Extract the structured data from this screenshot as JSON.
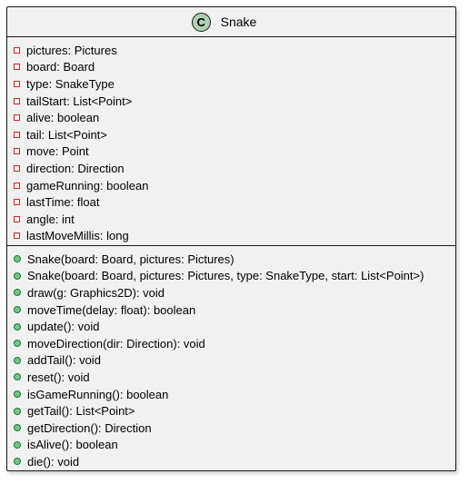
{
  "class": {
    "icon_letter": "C",
    "name": "Snake",
    "icon_color": "#add1b2"
  },
  "fields": [
    "pictures: Pictures",
    "board: Board",
    "type: SnakeType",
    "tailStart: List<Point>",
    "alive: boolean",
    "tail: List<Point>",
    "move: Point",
    "direction: Direction",
    "gameRunning: boolean",
    "lastTime: float",
    "angle: int",
    "lastMoveMillis: long"
  ],
  "methods": [
    "Snake(board: Board, pictures: Pictures)",
    "Snake(board: Board, pictures: Pictures, type: SnakeType, start: List<Point>)",
    "draw(g: Graphics2D): void",
    "moveTime(delay: float): boolean",
    "update(): void",
    "moveDirection(dir: Direction): void",
    "addTail(): void",
    "reset(): void",
    "isGameRunning(): boolean",
    "getTail(): List<Point>",
    "getDirection(): Direction",
    "isAlive(): boolean",
    "die(): void"
  ],
  "visibility": {
    "field_icon": "private-field-icon",
    "method_icon": "public-method-icon",
    "private_color": "#c82930",
    "public_color": "#84be84"
  }
}
